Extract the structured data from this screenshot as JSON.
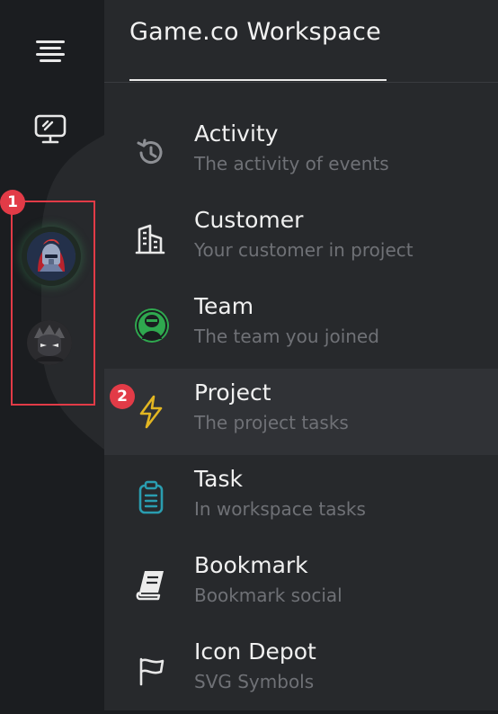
{
  "workspace": {
    "title": "Game.co Workspace"
  },
  "menu": [
    {
      "label": "Activity",
      "sub": "The activity of events",
      "icon": "history-icon"
    },
    {
      "label": "Customer",
      "sub": "Your customer in project",
      "icon": "building-icon"
    },
    {
      "label": "Team",
      "sub": "The team you joined",
      "icon": "team-alien-icon"
    },
    {
      "label": "Project",
      "sub": "The project tasks",
      "icon": "lightning-icon"
    },
    {
      "label": "Task",
      "sub": "In workspace tasks",
      "icon": "clipboard-icon"
    },
    {
      "label": "Bookmark",
      "sub": "Bookmark social",
      "icon": "book-icon"
    },
    {
      "label": "Icon Depot",
      "sub": "SVG Symbols",
      "icon": "flag-icon"
    }
  ],
  "active_index": 3,
  "badges": {
    "one": "1",
    "two": "2"
  },
  "colors": {
    "accent_red": "#e23b47",
    "team_green": "#2fa84f",
    "project_yellow": "#e2b622",
    "task_teal": "#2a9db0"
  }
}
